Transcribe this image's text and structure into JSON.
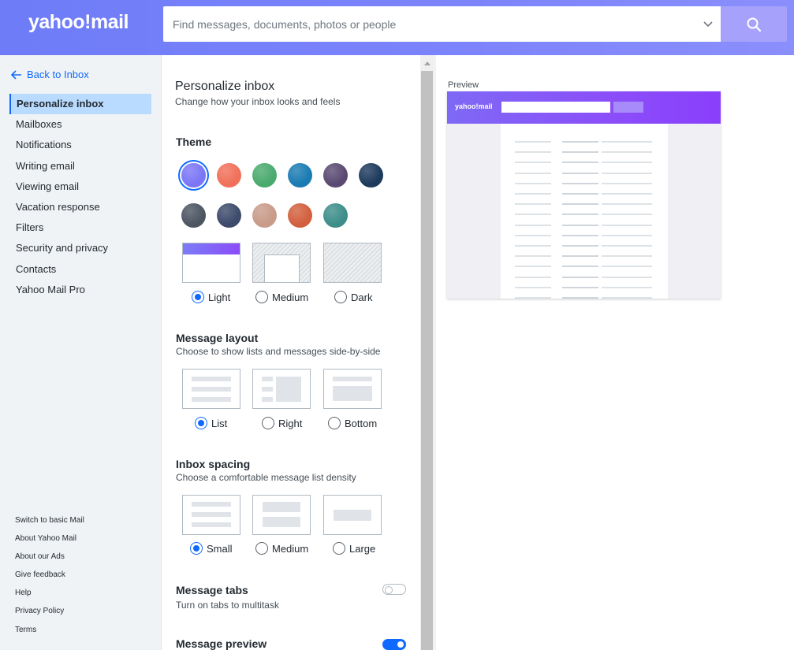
{
  "header": {
    "logo_text": "yahoo!mail",
    "search_placeholder": "Find messages, documents, photos or people",
    "icons": {
      "chevron": "chevron-down-icon",
      "search": "search-icon"
    },
    "colors": {
      "bar": "#7b83fa",
      "search_button": "#a6a2fb"
    }
  },
  "sidebar": {
    "back_label": "Back to Inbox",
    "items": [
      {
        "label": "Personalize inbox",
        "active": true
      },
      {
        "label": "Mailboxes"
      },
      {
        "label": "Notifications"
      },
      {
        "label": "Writing email"
      },
      {
        "label": "Viewing email"
      },
      {
        "label": "Vacation response"
      },
      {
        "label": "Filters"
      },
      {
        "label": "Security and privacy"
      },
      {
        "label": "Contacts"
      },
      {
        "label": "Yahoo Mail Pro"
      }
    ],
    "footer": [
      "Switch to basic Mail",
      "About Yahoo Mail",
      "About our Ads",
      "Give feedback",
      "Help",
      "Privacy Policy",
      "Terms"
    ]
  },
  "panel": {
    "title": "Personalize inbox",
    "subtitle": "Change how your inbox looks and feels",
    "theme": {
      "title": "Theme",
      "swatches": [
        {
          "name": "purple",
          "color": "#7b76f6",
          "selected": true
        },
        {
          "name": "sunset",
          "color": "#f0705a"
        },
        {
          "name": "green",
          "color": "#4aaa6e"
        },
        {
          "name": "ocean",
          "color": "#1a7bb3"
        },
        {
          "name": "dusk",
          "color": "#5a4a72"
        },
        {
          "name": "navy",
          "color": "#1d3a5c"
        },
        {
          "name": "slate",
          "color": "#4d5563"
        },
        {
          "name": "mountains",
          "color": "#3d4a6b"
        },
        {
          "name": "desert",
          "color": "#c89b8a"
        },
        {
          "name": "canyon",
          "color": "#d2603e"
        },
        {
          "name": "lake",
          "color": "#3d8e8a"
        }
      ],
      "modes": [
        {
          "label": "Light",
          "checked": true
        },
        {
          "label": "Medium"
        },
        {
          "label": "Dark"
        }
      ]
    },
    "layout": {
      "title": "Message layout",
      "desc": "Choose to show lists and messages side-by-side",
      "options": [
        {
          "label": "List",
          "checked": true
        },
        {
          "label": "Right"
        },
        {
          "label": "Bottom"
        }
      ]
    },
    "spacing": {
      "title": "Inbox spacing",
      "desc": "Choose a comfortable message list density",
      "options": [
        {
          "label": "Small",
          "checked": true
        },
        {
          "label": "Medium"
        },
        {
          "label": "Large"
        }
      ]
    },
    "tabs": {
      "title": "Message tabs",
      "desc": "Turn on tabs to multitask",
      "enabled": false
    },
    "preview_setting": {
      "title": "Message preview",
      "enabled": true
    }
  },
  "preview": {
    "label": "Preview",
    "logo_text": "yahoo!mail"
  }
}
